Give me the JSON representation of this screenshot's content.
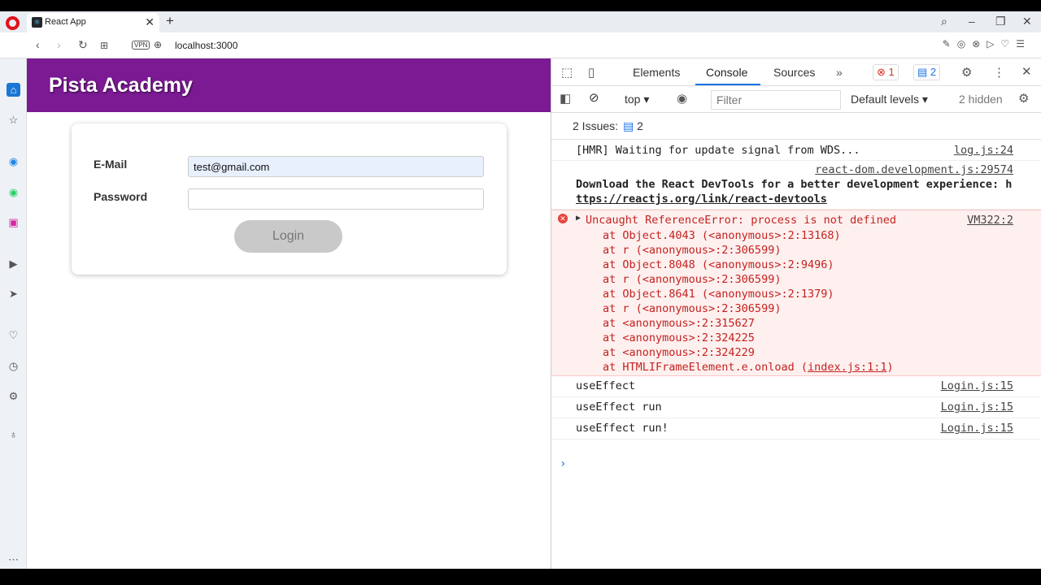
{
  "browser": {
    "tab_title": "React App",
    "tab_close": "✕",
    "new_tab": "+",
    "url": "localhost:3000",
    "vpn_label": "VPN"
  },
  "page": {
    "header_title": "Pista Academy",
    "email_label": "E-Mail",
    "email_value": "test@gmail.com",
    "password_label": "Password",
    "password_value": "",
    "login_label": "Login"
  },
  "devtools": {
    "tabs": [
      "Elements",
      "Console",
      "Sources"
    ],
    "more_tabs": "»",
    "error_count": "1",
    "issue_count": "2",
    "context": "top",
    "filter_placeholder": "Filter",
    "levels": "Default levels",
    "hidden": "2 hidden",
    "issues_label": "2 Issues:",
    "issues_count": "2",
    "console": {
      "hmr": {
        "text": "[HMR] Waiting for update signal from WDS...",
        "source": "log.js:24"
      },
      "react_src": "react-dom.development.js:29574",
      "react_text_1": "Download the React DevTools for a better development experience: h",
      "react_text_2": "ttps://reactjs.org/link/react-devtools",
      "error": {
        "title": "Uncaught ReferenceError: process is not defined",
        "source": "VM322:2",
        "stack": [
          "at Object.4043 (<anonymous>:2:13168)",
          "at r (<anonymous>:2:306599)",
          "at Object.8048 (<anonymous>:2:9496)",
          "at r (<anonymous>:2:306599)",
          "at Object.8641 (<anonymous>:2:1379)",
          "at r (<anonymous>:2:306599)",
          "at <anonymous>:2:315627",
          "at <anonymous>:2:324225",
          "at <anonymous>:2:324229"
        ],
        "last_prefix": "at HTMLIFrameElement.e.onload (",
        "last_link": "index.js:1:1",
        "last_suffix": ")"
      },
      "logs": [
        {
          "text": "useEffect",
          "source": "Login.js:15"
        },
        {
          "text": "useEffect run",
          "source": "Login.js:15"
        },
        {
          "text": "useEffect run!",
          "source": "Login.js:15"
        }
      ]
    }
  },
  "colors": {
    "header_bg": "#7b1a93",
    "error_red": "#c5221f",
    "accent_blue": "#1a73e8"
  }
}
